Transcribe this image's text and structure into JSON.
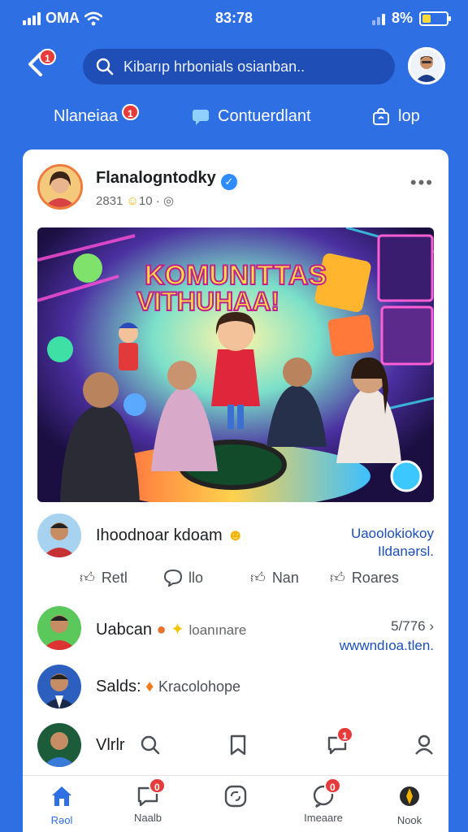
{
  "status": {
    "carrier": "OMA",
    "time": "83:78",
    "battery": "8%"
  },
  "header": {
    "back_badge": "1",
    "search_placeholder": "Kibarıp hrbonials osianban.."
  },
  "tabs": [
    {
      "label": "Nlaneiaa",
      "badge": "1"
    },
    {
      "label": "Contuerdlant"
    },
    {
      "label": "lop"
    }
  ],
  "post": {
    "author": "Flanalogntodky",
    "meta_a": "2831",
    "meta_b": "10",
    "image_title_1": "KOMUNITTAS",
    "image_title_2": "VITHUHAA!"
  },
  "comment": {
    "name": "Ihoodnoar kdoam",
    "link_line1": "Uaoolokiokoy",
    "link_line2": "Ildanərsl."
  },
  "actions": [
    {
      "label": "Retl"
    },
    {
      "label": "llo"
    },
    {
      "label": "Nan"
    },
    {
      "label": "Roares"
    }
  ],
  "list": [
    {
      "name": "Uabcan",
      "sub": "loanınare",
      "count": "5/776",
      "link": "wwwndıoa.tlen."
    },
    {
      "name": "Salds:",
      "sub": "Kracolohope"
    },
    {
      "name": "Vlrlr"
    }
  ],
  "list_badge": "1",
  "bottom_nav": [
    {
      "label": "Rəol",
      "active": true
    },
    {
      "label": "Naalb",
      "badge": "0"
    },
    {
      "label": ""
    },
    {
      "label": "Imeaare",
      "badge": "0"
    },
    {
      "label": "Nook"
    }
  ],
  "colors": {
    "primary": "#2f6fe4",
    "accent": "#1b4fb8",
    "badge": "#e63b3b"
  }
}
